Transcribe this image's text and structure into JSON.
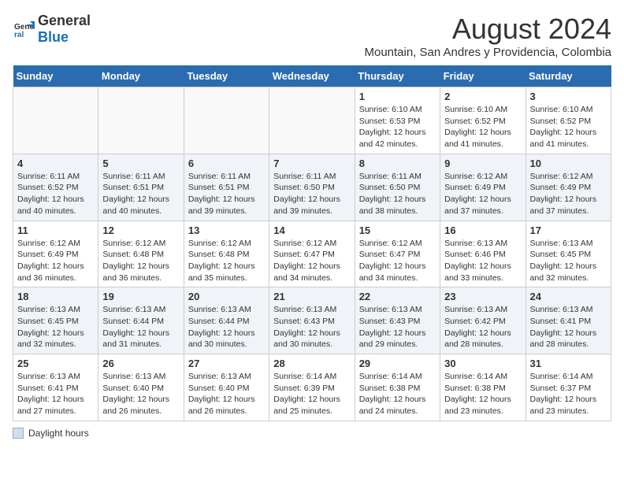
{
  "logo": {
    "general": "General",
    "blue": "Blue"
  },
  "header": {
    "month": "August 2024",
    "subtitle": "Mountain, San Andres y Providencia, Colombia"
  },
  "days_of_week": [
    "Sunday",
    "Monday",
    "Tuesday",
    "Wednesday",
    "Thursday",
    "Friday",
    "Saturday"
  ],
  "legend": {
    "label": "Daylight hours"
  },
  "weeks": [
    [
      {
        "day": "",
        "info": ""
      },
      {
        "day": "",
        "info": ""
      },
      {
        "day": "",
        "info": ""
      },
      {
        "day": "",
        "info": ""
      },
      {
        "day": "1",
        "info": "Sunrise: 6:10 AM\nSunset: 6:53 PM\nDaylight: 12 hours and 42 minutes."
      },
      {
        "day": "2",
        "info": "Sunrise: 6:10 AM\nSunset: 6:52 PM\nDaylight: 12 hours and 41 minutes."
      },
      {
        "day": "3",
        "info": "Sunrise: 6:10 AM\nSunset: 6:52 PM\nDaylight: 12 hours and 41 minutes."
      }
    ],
    [
      {
        "day": "4",
        "info": "Sunrise: 6:11 AM\nSunset: 6:52 PM\nDaylight: 12 hours and 40 minutes."
      },
      {
        "day": "5",
        "info": "Sunrise: 6:11 AM\nSunset: 6:51 PM\nDaylight: 12 hours and 40 minutes."
      },
      {
        "day": "6",
        "info": "Sunrise: 6:11 AM\nSunset: 6:51 PM\nDaylight: 12 hours and 39 minutes."
      },
      {
        "day": "7",
        "info": "Sunrise: 6:11 AM\nSunset: 6:50 PM\nDaylight: 12 hours and 39 minutes."
      },
      {
        "day": "8",
        "info": "Sunrise: 6:11 AM\nSunset: 6:50 PM\nDaylight: 12 hours and 38 minutes."
      },
      {
        "day": "9",
        "info": "Sunrise: 6:12 AM\nSunset: 6:49 PM\nDaylight: 12 hours and 37 minutes."
      },
      {
        "day": "10",
        "info": "Sunrise: 6:12 AM\nSunset: 6:49 PM\nDaylight: 12 hours and 37 minutes."
      }
    ],
    [
      {
        "day": "11",
        "info": "Sunrise: 6:12 AM\nSunset: 6:49 PM\nDaylight: 12 hours and 36 minutes."
      },
      {
        "day": "12",
        "info": "Sunrise: 6:12 AM\nSunset: 6:48 PM\nDaylight: 12 hours and 36 minutes."
      },
      {
        "day": "13",
        "info": "Sunrise: 6:12 AM\nSunset: 6:48 PM\nDaylight: 12 hours and 35 minutes."
      },
      {
        "day": "14",
        "info": "Sunrise: 6:12 AM\nSunset: 6:47 PM\nDaylight: 12 hours and 34 minutes."
      },
      {
        "day": "15",
        "info": "Sunrise: 6:12 AM\nSunset: 6:47 PM\nDaylight: 12 hours and 34 minutes."
      },
      {
        "day": "16",
        "info": "Sunrise: 6:13 AM\nSunset: 6:46 PM\nDaylight: 12 hours and 33 minutes."
      },
      {
        "day": "17",
        "info": "Sunrise: 6:13 AM\nSunset: 6:45 PM\nDaylight: 12 hours and 32 minutes."
      }
    ],
    [
      {
        "day": "18",
        "info": "Sunrise: 6:13 AM\nSunset: 6:45 PM\nDaylight: 12 hours and 32 minutes."
      },
      {
        "day": "19",
        "info": "Sunrise: 6:13 AM\nSunset: 6:44 PM\nDaylight: 12 hours and 31 minutes."
      },
      {
        "day": "20",
        "info": "Sunrise: 6:13 AM\nSunset: 6:44 PM\nDaylight: 12 hours and 30 minutes."
      },
      {
        "day": "21",
        "info": "Sunrise: 6:13 AM\nSunset: 6:43 PM\nDaylight: 12 hours and 30 minutes."
      },
      {
        "day": "22",
        "info": "Sunrise: 6:13 AM\nSunset: 6:43 PM\nDaylight: 12 hours and 29 minutes."
      },
      {
        "day": "23",
        "info": "Sunrise: 6:13 AM\nSunset: 6:42 PM\nDaylight: 12 hours and 28 minutes."
      },
      {
        "day": "24",
        "info": "Sunrise: 6:13 AM\nSunset: 6:41 PM\nDaylight: 12 hours and 28 minutes."
      }
    ],
    [
      {
        "day": "25",
        "info": "Sunrise: 6:13 AM\nSunset: 6:41 PM\nDaylight: 12 hours and 27 minutes."
      },
      {
        "day": "26",
        "info": "Sunrise: 6:13 AM\nSunset: 6:40 PM\nDaylight: 12 hours and 26 minutes."
      },
      {
        "day": "27",
        "info": "Sunrise: 6:13 AM\nSunset: 6:40 PM\nDaylight: 12 hours and 26 minutes."
      },
      {
        "day": "28",
        "info": "Sunrise: 6:14 AM\nSunset: 6:39 PM\nDaylight: 12 hours and 25 minutes."
      },
      {
        "day": "29",
        "info": "Sunrise: 6:14 AM\nSunset: 6:38 PM\nDaylight: 12 hours and 24 minutes."
      },
      {
        "day": "30",
        "info": "Sunrise: 6:14 AM\nSunset: 6:38 PM\nDaylight: 12 hours and 23 minutes."
      },
      {
        "day": "31",
        "info": "Sunrise: 6:14 AM\nSunset: 6:37 PM\nDaylight: 12 hours and 23 minutes."
      }
    ]
  ]
}
